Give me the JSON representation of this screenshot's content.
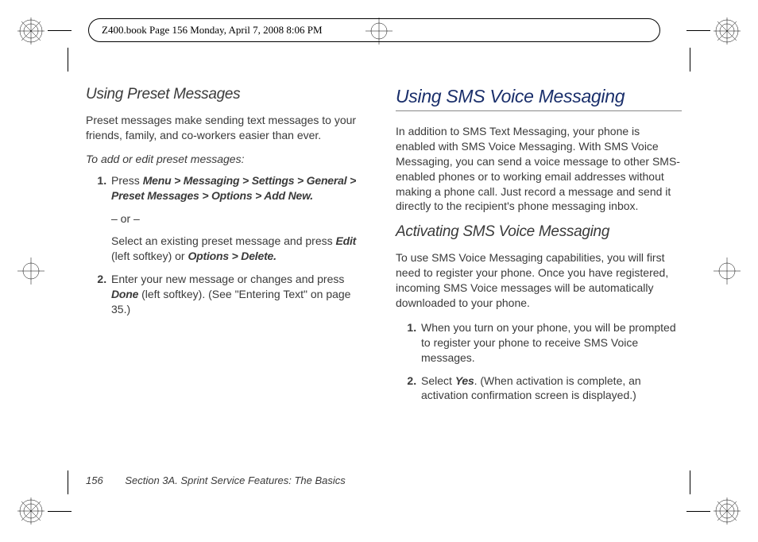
{
  "header": {
    "text": "Z400.book  Page 156  Monday, April 7, 2008  8:06 PM"
  },
  "left": {
    "subheading": "Using Preset Messages",
    "intro": "Preset messages make sending text messages to your friends, family, and co-workers easier than ever.",
    "instructions_label": "To add or edit preset messages:",
    "step1_prefix": "Press ",
    "step1_menu": "Menu > Messaging > Settings > General > Preset Messages > Options > Add New.",
    "step1_or": "– or –",
    "step1_alt_a": "Select an existing preset message and press ",
    "step1_alt_edit": "Edit",
    "step1_alt_b": " (left softkey) or ",
    "step1_alt_opt": "Options > Delete.",
    "step2_a": "Enter your new message or changes and press ",
    "step2_done": "Done",
    "step2_b": " (left softkey). (See \"Entering Text\" on page 35.)"
  },
  "right": {
    "heading": "Using SMS Voice Messaging",
    "intro": "In addition to SMS Text Messaging, your phone is enabled with SMS Voice Messaging. With SMS Voice Messaging, you can send a voice message to other SMS-enabled phones or to working email addresses without making a phone call. Just record a message and send it directly to the recipient's phone messaging inbox.",
    "subheading": "Activating SMS Voice Messaging",
    "para2": "To use SMS Voice Messaging capabilities, you will first need to register your phone. Once you have registered, incoming SMS Voice messages will be automatically downloaded to your phone.",
    "step1": "When you turn on your phone, you will be prompted to register your phone to receive SMS Voice messages.",
    "step2_a": "Select ",
    "step2_yes": "Yes",
    "step2_b": ". (When activation is complete, an activation confirmation screen is displayed.)"
  },
  "footer": {
    "page": "156",
    "section": "Section 3A. Sprint Service Features: The Basics"
  }
}
